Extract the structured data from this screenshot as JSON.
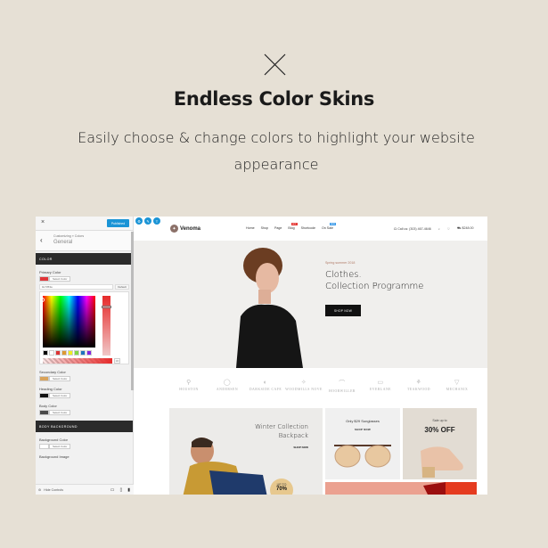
{
  "hero": {
    "icon": "close-x-icon",
    "title": "Endless Color Skins",
    "subtitle": "Easily choose & change colors to highlight your website appearance"
  },
  "customizer": {
    "close_icon": "×",
    "publish_label": "Published",
    "back_icon": "‹",
    "breadcrumb": "Customizing » Colors",
    "section_title": "General",
    "color_header": "COLOR",
    "primary_label": "Primary Color",
    "primary_color": "#e0353a",
    "select_label": "Select Color",
    "hex_value": "#e7353a",
    "default_label": "Default",
    "palette": [
      "#000000",
      "#ffffff",
      "#dd3333",
      "#dd9933",
      "#eeee22",
      "#81d742",
      "#1e73be",
      "#8224e3"
    ],
    "alpha_value": "100",
    "secondary_label": "Secondary Color",
    "secondary_color": "#d9a35a",
    "heading_label": "Heading Color",
    "heading_color": "#111111",
    "body_label": "Body Color",
    "body_color": "#4a4a4a",
    "body_bg_header": "BODY BACKGROUND",
    "bg_label": "Background Color",
    "bg_color": "#ffffff",
    "bg_image_label": "Background Image",
    "hide_controls": "Hide Controls",
    "hide_icon": "⚙",
    "devices": [
      "desktop-icon",
      "tablet-icon",
      "mobile-icon"
    ]
  },
  "float_icons": [
    "⚙",
    "✎",
    "T"
  ],
  "site": {
    "logo_text": "Venoma",
    "nav": [
      {
        "label": "Home"
      },
      {
        "label": "Shop"
      },
      {
        "label": "Page"
      },
      {
        "label": "Blog",
        "badge": "HOT",
        "badge_color": "#e53935"
      },
      {
        "label": "Shortcode"
      },
      {
        "label": "On Sale",
        "badge": "NEW",
        "badge_color": "#3d9be9"
      }
    ],
    "phone": "Call us: (303) 467-4646",
    "cart_total": "$248.00",
    "hero_season": "Spring summer 2018",
    "hero_title_1": "Clothes.",
    "hero_title_2": "Collection Programme",
    "hero_button": "SHOP NOW",
    "brands": [
      "HOUSTON",
      "ANDERSEN",
      "DARKSIDE CAFE",
      "WOODMILLS NOVE",
      "HOORWILLER",
      "EVERLANE",
      "TEAKWOOD",
      "MECHANIX"
    ],
    "promo_a_title_1": "Winter Collection",
    "promo_a_title_2": "Backpack",
    "promo_a_link": "SHOP NOW",
    "promo_a_badge_top": "UP TO",
    "promo_a_badge_value": "70%",
    "promo_b_title": "Only $29 Sunglasses",
    "promo_b_link": "SHOP NOW",
    "promo_c_sub": "Sale up to",
    "promo_c_big": "30% OFF"
  }
}
